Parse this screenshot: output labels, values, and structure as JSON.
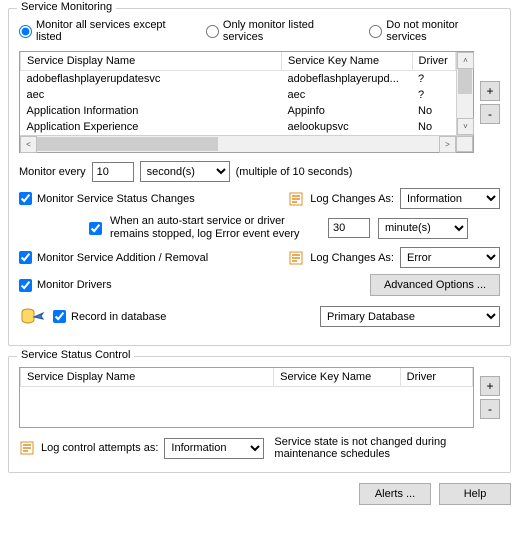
{
  "monitoring": {
    "group_title": "Service Monitoring",
    "radios": {
      "except": "Monitor all services except listed",
      "only": "Only monitor listed services",
      "none": "Do not monitor services",
      "selected": "except"
    },
    "table": {
      "headers": {
        "display": "Service Display Name",
        "key": "Service Key Name",
        "driver": "Driver"
      },
      "rows": [
        {
          "display": "adobeflashplayerupdatesvc",
          "key": "adobeflashplayerupd...",
          "driver": "?"
        },
        {
          "display": "aec",
          "key": "aec",
          "driver": "?"
        },
        {
          "display": "Application Information",
          "key": "Appinfo",
          "driver": "No"
        },
        {
          "display": "Application Experience",
          "key": "aelookupsvc",
          "driver": "No"
        }
      ]
    },
    "buttons": {
      "plus": "+",
      "minus": "-"
    },
    "monitor_every": {
      "label": "Monitor every",
      "value": "10",
      "unit": "second(s)",
      "hint": "(multiple of 10 seconds)"
    },
    "status_changes": {
      "label": "Monitor Service Status Changes",
      "checked": true,
      "log_as_label": "Log Changes As:",
      "log_as_value": "Information"
    },
    "auto_start": {
      "label": "When an auto-start service or driver remains stopped, log Error event every",
      "checked": true,
      "value": "30",
      "unit": "minute(s)"
    },
    "add_remove": {
      "label": "Monitor Service Addition / Removal",
      "checked": true,
      "log_as_label": "Log Changes As:",
      "log_as_value": "Error"
    },
    "drivers": {
      "label": "Monitor Drivers",
      "checked": true,
      "adv_btn": "Advanced Options ..."
    },
    "record_db": {
      "label": "Record in database",
      "checked": true,
      "value": "Primary Database"
    }
  },
  "status_control": {
    "group_title": "Service Status Control",
    "table": {
      "headers": {
        "display": "Service Display Name",
        "key": "Service Key Name",
        "driver": "Driver"
      }
    },
    "buttons": {
      "plus": "+",
      "minus": "-"
    },
    "log_attempts": {
      "label": "Log control attempts as:",
      "value": "Information"
    },
    "note": "Service state is not changed during maintenance schedules"
  },
  "footer": {
    "alerts": "Alerts ...",
    "help": "Help"
  }
}
